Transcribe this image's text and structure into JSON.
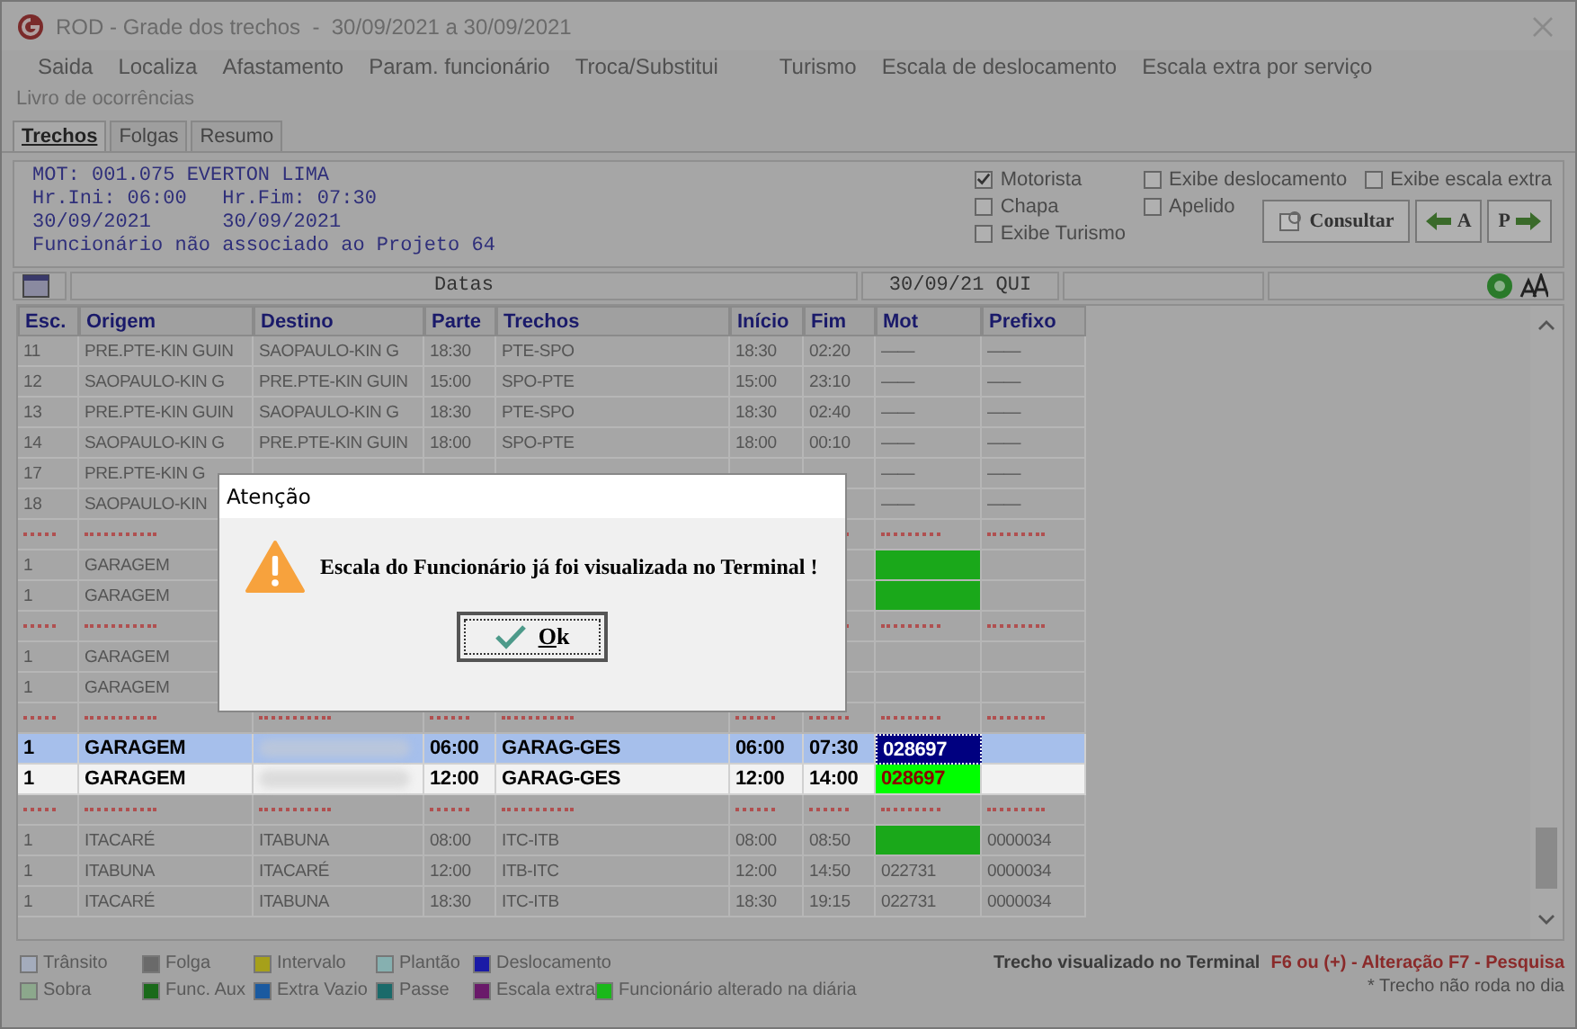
{
  "window": {
    "title": "ROD - Grade dos trechos  -  30/09/2021 a 30/09/2021"
  },
  "menu_rows": [
    [
      "Saida",
      "Localiza",
      "Afastamento",
      "Param. funcionário",
      "Troca/Substitui",
      "Turismo",
      "Escala de deslocamento",
      "Escala extra por serviço"
    ],
    [
      "Livro de ocorrências"
    ]
  ],
  "tabs": [
    {
      "label": "Trechos",
      "selected": true
    },
    {
      "label": "Folgas",
      "selected": false
    },
    {
      "label": "Resumo",
      "selected": false
    }
  ],
  "info_lines": [
    "MOT: 001.075 EVERTON LIMA",
    "Hr.Ini: 06:00   Hr.Fim: 07:30",
    "30/09/2021      30/09/2021",
    "Funcionário não associado ao Projeto 64"
  ],
  "option_columns": [
    [
      {
        "label": "Motorista",
        "checked": true
      },
      {
        "label": "Chapa",
        "checked": false
      },
      {
        "label": "Exibe Turismo",
        "checked": false
      }
    ],
    [
      {
        "label": "Exibe deslocamento",
        "checked": false
      },
      {
        "label": "Apelido",
        "checked": false
      }
    ],
    [
      {
        "label": "Exibe escala extra",
        "checked": false
      }
    ]
  ],
  "buttons": {
    "consult": "Consultar",
    "prev": "A",
    "next": "P"
  },
  "date_bar": {
    "label": "Datas",
    "date": "30/09/21 QUI"
  },
  "columns": [
    "Esc.",
    "Origem",
    "Destino",
    "Parte",
    "Trechos",
    "Início",
    "Fim",
    "Mot",
    "Prefixo"
  ],
  "rows": [
    {
      "kind": "trip",
      "selected": false,
      "emphasized": false,
      "cells": [
        "11",
        "PRE.PTE-KIN GUIN",
        "SAOPAULO-KIN G",
        "18:30",
        "PTE-SPO",
        "18:30",
        "02:20",
        "——",
        "——"
      ]
    },
    {
      "kind": "trip",
      "selected": false,
      "emphasized": false,
      "cells": [
        "12",
        "SAOPAULO-KIN G",
        "PRE.PTE-KIN GUIN",
        "15:00",
        "SPO-PTE",
        "15:00",
        "23:10",
        "——",
        "——"
      ]
    },
    {
      "kind": "trip",
      "selected": false,
      "emphasized": false,
      "cells": [
        "13",
        "PRE.PTE-KIN GUIN",
        "SAOPAULO-KIN G",
        "18:30",
        "PTE-SPO",
        "18:30",
        "02:40",
        "——",
        "——"
      ]
    },
    {
      "kind": "trip",
      "selected": false,
      "emphasized": false,
      "cells": [
        "14",
        "SAOPAULO-KIN G",
        "PRE.PTE-KIN GUIN",
        "18:00",
        "SPO-PTE",
        "18:00",
        "00:10",
        "——",
        "——"
      ]
    },
    {
      "kind": "trip",
      "selected": false,
      "emphasized": false,
      "cells": [
        "17",
        "PRE.PTE-KIN G",
        null,
        null,
        null,
        null,
        null,
        "——",
        "——"
      ]
    },
    {
      "kind": "trip",
      "selected": false,
      "emphasized": false,
      "cells": [
        "18",
        "SAOPAULO-KIN",
        null,
        null,
        null,
        null,
        null,
        "——",
        "——"
      ]
    },
    {
      "kind": "separator"
    },
    {
      "kind": "trip",
      "selected": false,
      "emphasized": false,
      "color": "#1aa81a",
      "cells": [
        "1",
        "GARAGEM",
        null,
        null,
        null,
        null,
        null,
        "",
        ""
      ]
    },
    {
      "kind": "trip",
      "selected": false,
      "emphasized": false,
      "color": "#1aa81a",
      "cells": [
        "1",
        "GARAGEM",
        null,
        null,
        null,
        null,
        null,
        "",
        ""
      ]
    },
    {
      "kind": "separator"
    },
    {
      "kind": "trip",
      "selected": false,
      "emphasized": false,
      "cells": [
        "1",
        "GARAGEM",
        null,
        null,
        null,
        null,
        null,
        "",
        ""
      ]
    },
    {
      "kind": "trip",
      "selected": false,
      "emphasized": false,
      "cells": [
        "1",
        "GARAGEM",
        null,
        null,
        null,
        null,
        null,
        "",
        ""
      ]
    },
    {
      "kind": "separator"
    },
    {
      "kind": "trip",
      "selected": true,
      "emphasized": true,
      "destino_blurred": true,
      "color": "#000080",
      "cells": [
        "1",
        "GARAGEM",
        "",
        "06:00",
        "GARAG-GES",
        "06:00",
        "07:30",
        "028697",
        ""
      ]
    },
    {
      "kind": "trip",
      "selected": false,
      "emphasized": true,
      "destino_blurred": true,
      "color": "#00ff00",
      "cells": [
        "1",
        "GARAGEM",
        "",
        "12:00",
        "GARAG-GES",
        "12:00",
        "14:00",
        "028697",
        ""
      ]
    },
    {
      "kind": "separator"
    },
    {
      "kind": "trip",
      "selected": false,
      "emphasized": false,
      "color": "#1aa81a",
      "cells": [
        "1",
        "ITACARÉ",
        "ITABUNA",
        "08:00",
        "ITC-ITB",
        "08:00",
        "08:50",
        "",
        "0000034"
      ]
    },
    {
      "kind": "trip",
      "selected": false,
      "emphasized": false,
      "cells": [
        "1",
        "ITABUNA",
        "ITACARÉ",
        "12:00",
        "ITB-ITC",
        "12:00",
        "14:50",
        "022731",
        "0000034"
      ]
    },
    {
      "kind": "trip",
      "selected": false,
      "emphasized": false,
      "cells": [
        "1",
        "ITACARÉ",
        "ITABUNA",
        "18:30",
        "ITC-ITB",
        "18:30",
        "19:15",
        "022731",
        "0000034"
      ]
    }
  ],
  "dialog": {
    "title": "Atenção",
    "message": "Escala do Funcionário já foi visualizada no Terminal !",
    "button": "Ok"
  },
  "legend_rows": [
    [
      {
        "label": "Trânsito",
        "color": "#a4acbc"
      },
      {
        "label": "Folga",
        "color": "#6a6a6a"
      },
      {
        "label": "Intervalo",
        "color": "#a6a01a"
      },
      {
        "label": "Plantão",
        "color": "#86b0b0"
      },
      {
        "label": "Deslocamento",
        "color": "#1a1aa6"
      }
    ],
    [
      {
        "label": "Sobra",
        "color": "#8ca88c"
      },
      {
        "label": "Func. Aux",
        "color": "#1a6a1a"
      },
      {
        "label": "Extra Vazio",
        "color": "#1a5aa0"
      },
      {
        "label": "Passe",
        "color": "#1a6a6a"
      },
      {
        "label": "Escala extra",
        "color": "#6a1a6a"
      },
      {
        "label": "Funcionário alterado na diária",
        "color": "#1ab81a"
      }
    ]
  ],
  "status": {
    "visualized": "Trecho visualizado no Terminal",
    "shortcuts": "F6 ou (+) - Alteração  F7 - Pesquisa",
    "note": "* Trecho não roda no dia"
  }
}
